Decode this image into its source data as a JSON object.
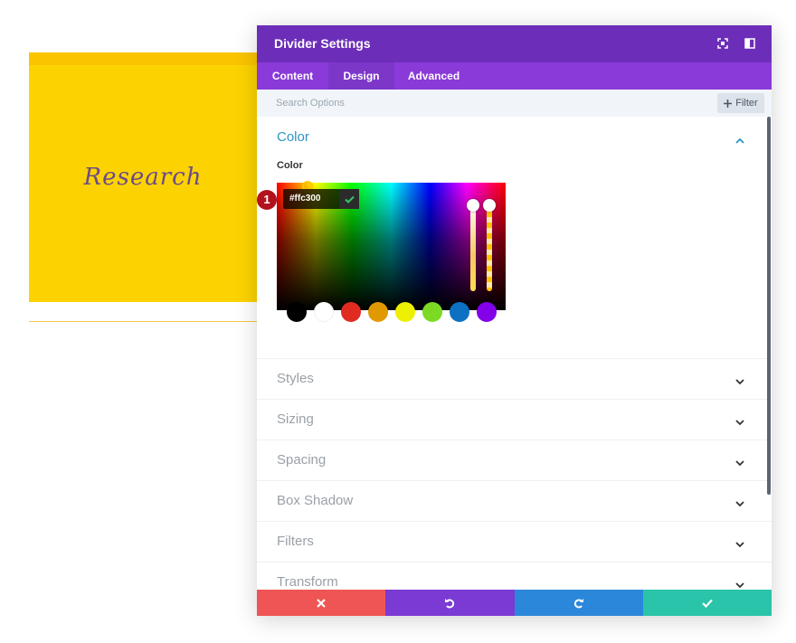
{
  "preview": {
    "card_text": "Research",
    "colors": {
      "card": "#fcd300",
      "topbar": "#fbc400"
    }
  },
  "modal": {
    "title": "Divider Settings",
    "header_icons": [
      "fullscreen-icon",
      "sidebar-toggle-icon"
    ],
    "tabs": [
      {
        "label": "Content",
        "active": false
      },
      {
        "label": "Design",
        "active": true
      },
      {
        "label": "Advanced",
        "active": false
      }
    ],
    "search": {
      "placeholder": "Search Options"
    },
    "filter_label": "Filter",
    "color_section": {
      "title": "Color",
      "field_label": "Color",
      "hex_value": "#ffc300",
      "step_badge": "1",
      "swatches": [
        "#000000",
        "#ffffff",
        "#e02b20",
        "#e09900",
        "#edf000",
        "#7cda24",
        "#0c71c3",
        "#8300e9"
      ]
    },
    "sections": [
      "Styles",
      "Sizing",
      "Spacing",
      "Box Shadow",
      "Filters",
      "Transform"
    ],
    "footer_buttons": [
      {
        "name": "cancel",
        "icon": "close-icon",
        "color": "#ef5555"
      },
      {
        "name": "undo",
        "icon": "undo-icon",
        "color": "#7b3ad4"
      },
      {
        "name": "redo",
        "icon": "redo-icon",
        "color": "#2b87da"
      },
      {
        "name": "save",
        "icon": "check-icon",
        "color": "#29c4a9"
      }
    ]
  },
  "colors": {
    "header": "#6c2eb9",
    "tabs": "#8a3ad8",
    "accent_blue": "#2e94c4"
  }
}
